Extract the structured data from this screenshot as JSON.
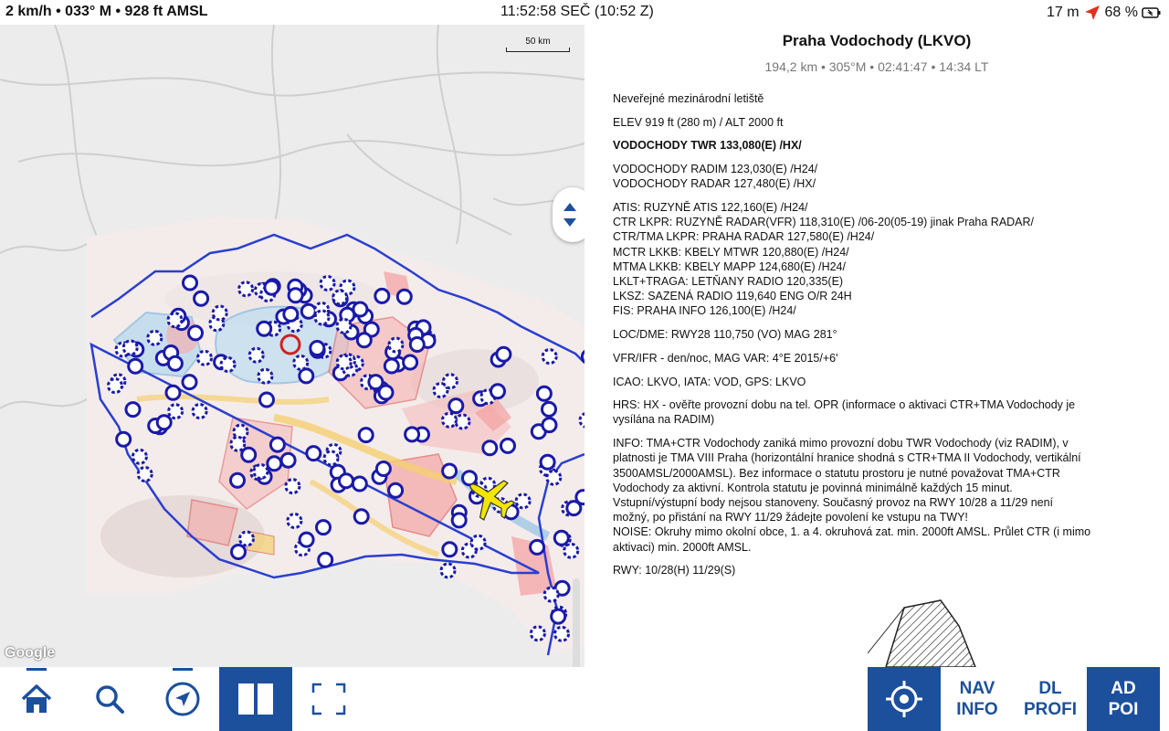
{
  "status_bar": {
    "left": "2 km/h • 033° M • 928 ft AMSL",
    "clock": "11:52:58 SEČ (10:52 Z)",
    "distance": "17 m",
    "battery": "68 %"
  },
  "map": {
    "scale_label": "50 km",
    "attribution": "Google"
  },
  "info": {
    "title": "Praha Vodochody (LKVO)",
    "subtitle": "194,2 km • 305°M • 02:41:47 • 14:34 LT",
    "paragraphs": [
      "Neveřejné mezinárodní letiště",
      "ELEV 919 ft (280 m) / ALT 2000 ft",
      "VODOCHODY TWR 133,080(E) /HX/",
      "VODOCHODY RADIM 123,030(E) /H24/\nVODOCHODY RADAR 127,480(E) /HX/",
      "ATIS: RUZYNĚ ATIS 122,160(E) /H24/\nCTR LKPR: RUZYNĚ RADAR(VFR) 118,310(E) /06-20(05-19) jinak Praha RADAR/\nCTR/TMA LKPR: PRAHA RADAR 127,580(E) /H24/\nMCTR LKKB: KBELY MTWR 120,880(E) /H24/\nMTMA LKKB: KBELY MAPP 124,680(E) /H24/\nLKLT+TRAGA: LETŇANY RADIO 120,335(E)\nLKSZ: SAZENÁ RADIO 119,640 ENG O/R 24H\nFIS: PRAHA INFO 126,100(E) /H24/",
      "LOC/DME: RWY28 110,750 (VO) MAG 281°",
      "VFR/IFR - den/noc, MAG VAR: 4°E 2015/+6'",
      "ICAO: LKVO, IATA: VOD, GPS: LKVO",
      "HRS: HX - ověřte provozní dobu na tel. OPR (informace o aktivaci CTR+TMA Vodochody je\nvysílána na RADIM)",
      "INFO: TMA+CTR Vodochody zaniká mimo provozní dobu TWR Vodochody (viz RADIM), v\nplatnosti je TMA VIII Praha (horizontální hranice shodná s CTR+TMA II Vodochody, vertikální\n3500AMSL/2000AMSL). Bez informace o statutu prostoru je nutné považovat TMA+CTR\nVodochody za aktivní. Kontrola statutu je povinná minimálně každých 15 minut.\nVstupní/výstupní body nejsou stanoveny. Současný provoz na RWY 10/28 a 11/29 není\nmožný, po přistání na RWY 11/29 žádejte povolení ke vstupu na TWY!\nNOISE: Okruhy mimo okolní obce, 1. a 4. okruhová zat. min. 2000ft AMSL. Průlet CTR (i mimo\naktivaci) min. 2000ft AMSL.",
      "RWY: 10/28(H) 11/29(S)"
    ]
  },
  "bottom_bar": {
    "nav_info": [
      "NAV",
      "INFO"
    ],
    "dl_profi": [
      "DL",
      "PROFI"
    ],
    "ad_poi": [
      "AD",
      "POI"
    ]
  },
  "colors": {
    "accent": "#1c4f9c",
    "poi_marker": "#1a1aa8",
    "aircraft": "#f2e600",
    "airspace_red": "#e05a5a",
    "airspace_blue": "#6cb0e0",
    "border": "#2a3fd0"
  },
  "icons": [
    "location-arrow-icon",
    "home-icon",
    "search-icon",
    "navigation-icon",
    "split-view-icon",
    "fullscreen-icon",
    "crosshair-icon",
    "up-down-arrows-icon",
    "battery-icon",
    "airplane-icon"
  ]
}
